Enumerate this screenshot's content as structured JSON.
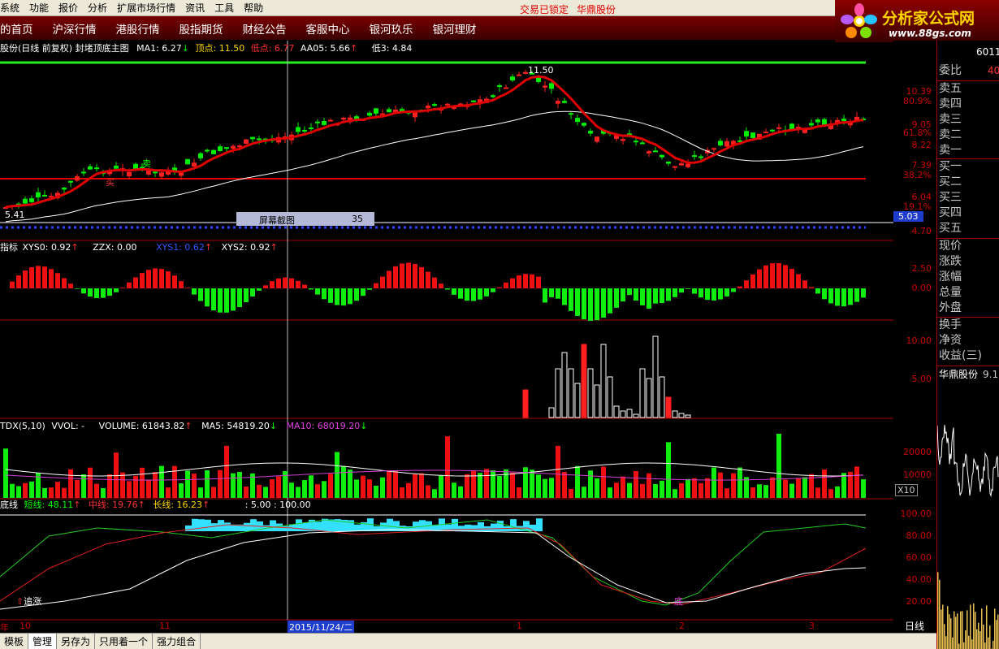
{
  "menu": [
    "系统",
    "功能",
    "报价",
    "分析",
    "扩展市场行情",
    "资讯",
    "工具",
    "帮助"
  ],
  "status": {
    "trade_locked": "交易已锁定",
    "broker": "华鼎股份"
  },
  "nav": [
    "的首页",
    "沪深行情",
    "港股行情",
    "股指期货",
    "财经公告",
    "客服中心",
    "银河玖乐",
    "银河理财"
  ],
  "logo": {
    "title": "分析家公式网",
    "site": "www.88gs.com"
  },
  "main_panel": {
    "title": "股份(日线 前复权) 封堵顶底主图",
    "ma1_label": "MA1: 6.27",
    "top_label": "顶点: 11.50",
    "low_label": "低点: 6.77",
    "aa05_label": "AA05: 5.66",
    "low3_label": "低3: 4.84",
    "peak_value": "11.50",
    "start_value": "5.41",
    "buy": "买",
    "sell": "卖",
    "popup_label": "屏幕截图",
    "popup_value": "35"
  },
  "indicator_panel": {
    "name": "指标",
    "xys0": "XYS0: 0.92",
    "zzx": "ZZX: 0.00",
    "xys1": "XYS1: 0.62",
    "xys2": "XYS2: 0.92"
  },
  "volume_panel": {
    "name": "TDX(5,10)",
    "vvol": "VVOL: -",
    "volume": "VOLUME: 61843.82",
    "ma5": "MA5: 54819.20",
    "ma10": "MA10: 68019.20"
  },
  "line_panel": {
    "name": "底线",
    "short": "短线: 48.11",
    "mid": "中线: 19.76",
    "long": "长线: 16.23",
    "extra": ": 5.00 : 100.00",
    "chase": "追涨",
    "bottom_tag": "底"
  },
  "price_axis": [
    "10.39",
    "80.9%",
    "9.05",
    "61.8%",
    "8.22",
    "7.39",
    "38.2%",
    "6.04",
    "19.1%",
    "4.70"
  ],
  "price_axis_highlight": "5.03",
  "ind_axis": [
    "2.50",
    "0.00"
  ],
  "mid_axis": [
    "10.00",
    "5.00"
  ],
  "vol_axis": [
    "20000",
    "10000"
  ],
  "vol_unit": "X10",
  "line_axis": [
    "100.00",
    "80.00",
    "60.00",
    "40.00",
    "20.00"
  ],
  "x_axis": {
    "year_label": "年",
    "m10": "10",
    "m11": "11",
    "date": "2015/11/24/二",
    "m1": "1",
    "m2": "2",
    "m3": "3"
  },
  "right_panel": {
    "code": "6011",
    "ratio_label": "委比",
    "ratio_value": "40",
    "orders": [
      "卖五",
      "卖四",
      "卖三",
      "卖二",
      "卖一",
      "买一",
      "买二",
      "买三",
      "买四",
      "买五"
    ],
    "stats": [
      "现价",
      "涨跌",
      "涨幅",
      "总量",
      "外盘",
      "换手",
      "净资",
      "收益(三)"
    ],
    "stock_name": "华鼎股份",
    "stock_price": "9.1",
    "period": "日线"
  },
  "bottom_tabs": [
    "模板",
    "管理",
    "另存为",
    "只用着一个",
    "强力组合"
  ],
  "colors": {
    "up": "#ff2020",
    "down": "#00ff00",
    "accent": "#ffd600",
    "bg": "#000000",
    "grid": "#8b0000"
  },
  "chart_data": {
    "type": "line",
    "title": "封堵顶底主图",
    "x": [
      "10",
      "11",
      "2015/11/24",
      "1",
      "2",
      "3"
    ],
    "price_high": 11.5,
    "price_start": 5.41,
    "ylim": [
      4.7,
      11.5
    ],
    "indicator_ylim": [
      0.0,
      2.5
    ],
    "volume_ylim": [
      0,
      20000
    ],
    "line_ylim": [
      0,
      100
    ]
  }
}
